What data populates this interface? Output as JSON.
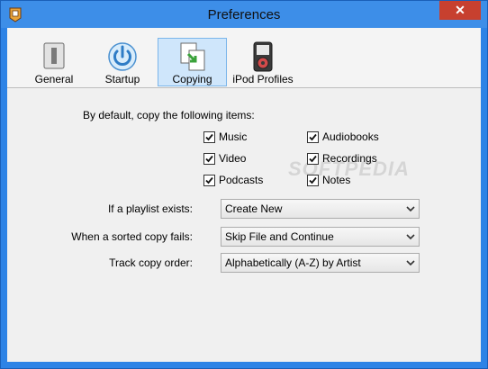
{
  "window": {
    "title": "Preferences",
    "close_symbol": "✕"
  },
  "toolbar": {
    "tabs": [
      {
        "label": "General",
        "icon": "general-icon"
      },
      {
        "label": "Startup",
        "icon": "power-icon"
      },
      {
        "label": "Copying",
        "icon": "copy-icon",
        "active": true
      },
      {
        "label": "iPod Profiles",
        "icon": "ipod-icon"
      }
    ]
  },
  "copying": {
    "intro": "By default, copy the following items:",
    "items": [
      {
        "label": "Music",
        "checked": true
      },
      {
        "label": "Audiobooks",
        "checked": true
      },
      {
        "label": "Video",
        "checked": true
      },
      {
        "label": "Recordings",
        "checked": true
      },
      {
        "label": "Podcasts",
        "checked": true
      },
      {
        "label": "Notes",
        "checked": true
      }
    ],
    "playlist_label": "If a playlist exists:",
    "playlist_value": "Create New",
    "sorted_fail_label": "When a sorted copy fails:",
    "sorted_fail_value": "Skip File and Continue",
    "order_label": "Track copy order:",
    "order_value": "Alphabetically (A-Z) by Artist"
  },
  "watermark": "SOFTPEDIA",
  "colors": {
    "title_bar": "#3d8ee8",
    "close_button": "#c7402f",
    "active_tab": "#cfe6fb"
  }
}
